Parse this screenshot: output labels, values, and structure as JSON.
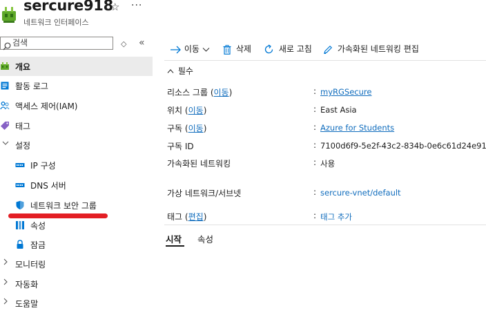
{
  "header": {
    "title": "sercure918",
    "subtitle": "네트워크 인터페이스",
    "star_glyph": "☆",
    "more_glyph": "···"
  },
  "search": {
    "placeholder": "검색",
    "filter_glyph": "◇",
    "collapse_glyph": "«"
  },
  "sidebar": {
    "items": [
      {
        "label": "개요",
        "icon": "network-interface-icon",
        "selected": true
      },
      {
        "label": "활동 로그",
        "icon": "activity-log-icon"
      },
      {
        "label": "액세스 제어(IAM)",
        "icon": "iam-people-icon"
      },
      {
        "label": "태그",
        "icon": "tag-icon"
      },
      {
        "label": "설정",
        "icon": "chevron-down-icon",
        "expandable": true,
        "expanded": true
      },
      {
        "label": "IP 구성",
        "icon": "ip-config-icon"
      },
      {
        "label": "DNS 서버",
        "icon": "dns-server-icon"
      },
      {
        "label": "네트워크 보안 그룹",
        "icon": "shield-icon"
      },
      {
        "label": "속성",
        "icon": "properties-icon"
      },
      {
        "label": "잠금",
        "icon": "lock-icon"
      },
      {
        "label": "모니터링",
        "icon": "chevron-right-icon",
        "expandable": true
      },
      {
        "label": "자동화",
        "icon": "chevron-right-icon",
        "expandable": true
      },
      {
        "label": "도움말",
        "icon": "chevron-right-icon",
        "expandable": true
      }
    ]
  },
  "toolbar": {
    "move_label": "이동",
    "delete_label": "삭제",
    "refresh_label": "새로 고침",
    "edit_accel_label": "가속화된 네트워킹 편집"
  },
  "essentials": {
    "toggle_label": "필수",
    "change_link": "이동",
    "edit_link": "편집",
    "rows": [
      {
        "label": "리소스 그룹",
        "value": "myRGSecure"
      },
      {
        "label": "위치",
        "value": "East Asia"
      },
      {
        "label": "구독",
        "value": "Azure for Students"
      },
      {
        "label": "구독 ID",
        "value": "7100d6f9-5e2f-43c2-834b-0e6c61d24e91"
      },
      {
        "label": "가속화된 네트워킹",
        "value": "사용"
      },
      {
        "label": "가상 네트워크/서브넷",
        "value": "sercure-vnet/default"
      },
      {
        "label": "태그",
        "value": "태그 추가"
      }
    ]
  },
  "tabs": [
    {
      "label": "시작",
      "active": true
    },
    {
      "label": "속성"
    }
  ],
  "colors": {
    "link": "#0f6cbd",
    "selected_bg": "#ebebeb",
    "annotation_red": "#e31e24",
    "accent": "#0078d4"
  }
}
